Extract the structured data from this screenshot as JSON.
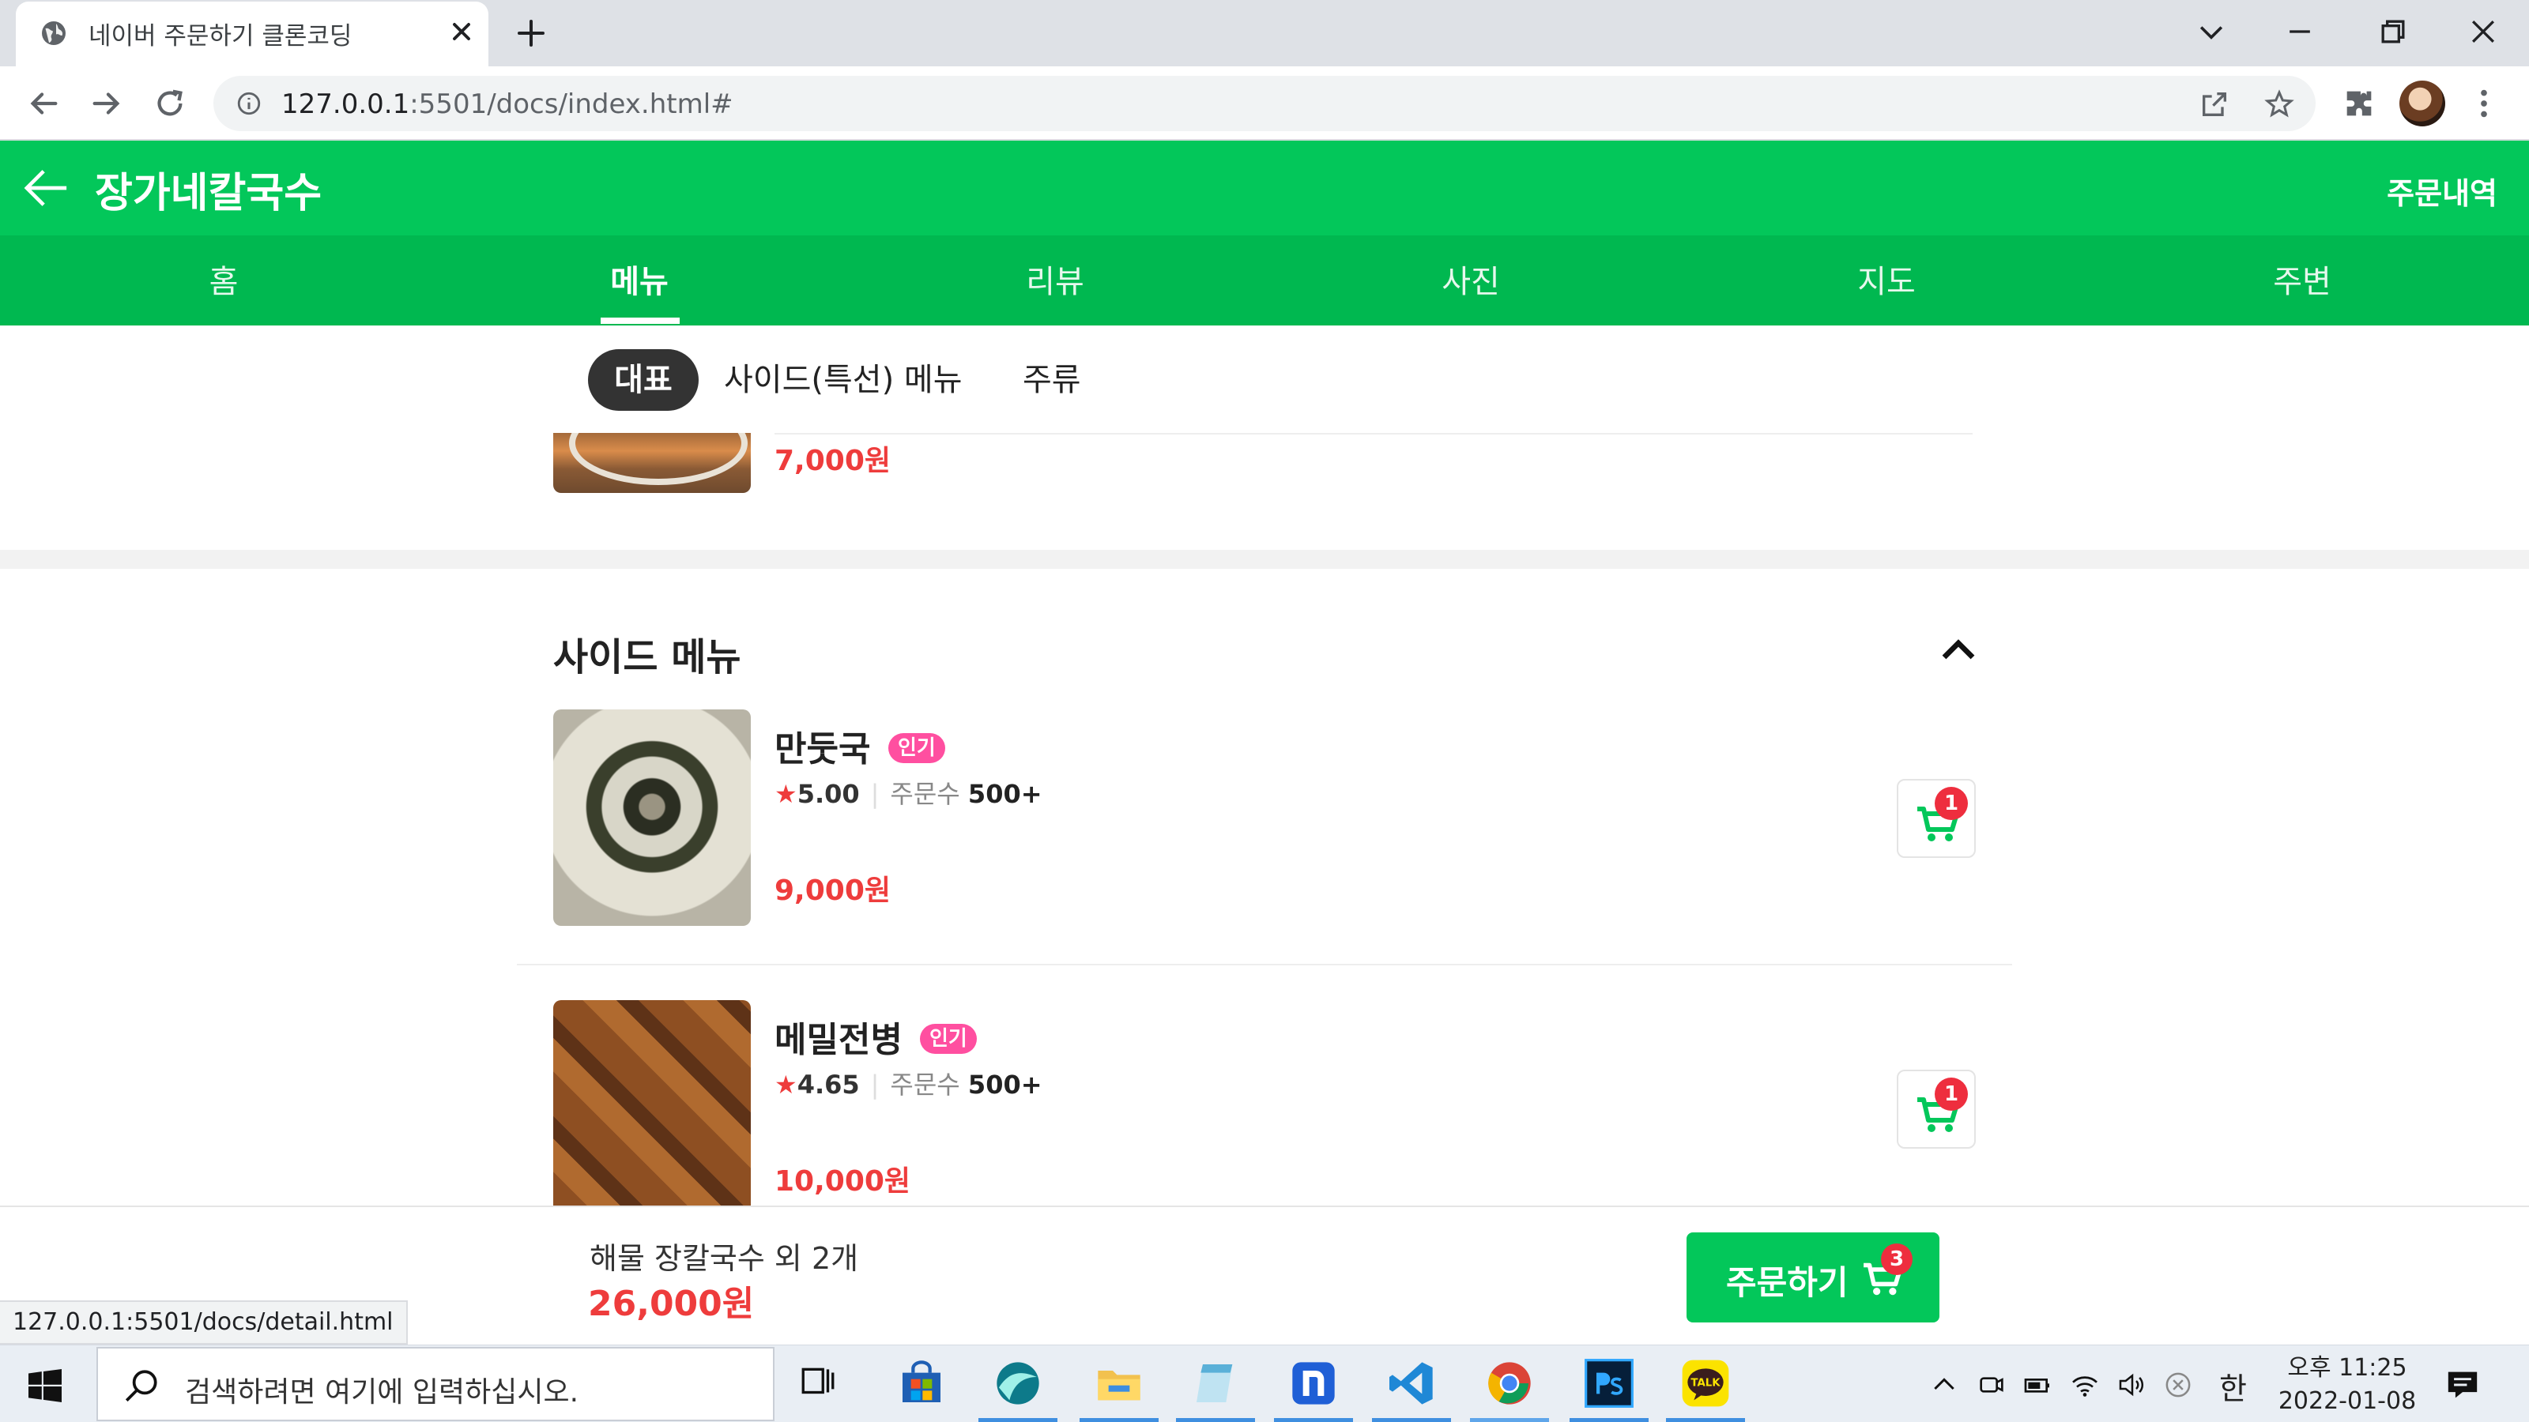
{
  "browser": {
    "tab_title": "네이버 주문하기 클론코딩",
    "url_host": "127.0.0.1",
    "url_rest": ":5501/docs/index.html#",
    "status_url": "127.0.0.1:5501/docs/detail.html"
  },
  "header": {
    "store_name": "장가네칼국수",
    "order_history": "주문내역"
  },
  "nav": {
    "tabs": [
      {
        "label": "홈"
      },
      {
        "label": "메뉴"
      },
      {
        "label": "리뷰"
      },
      {
        "label": "사진"
      },
      {
        "label": "지도"
      },
      {
        "label": "주변"
      }
    ],
    "active_index": 1
  },
  "subcategories": [
    {
      "label": "대표"
    },
    {
      "label": "사이드(특선) 메뉴"
    },
    {
      "label": "주류"
    }
  ],
  "previous_item": {
    "price": "7,000원"
  },
  "side_section": {
    "title": "사이드 메뉴",
    "items": [
      {
        "name": "만둣국",
        "badge": "인기",
        "star": "★",
        "rating": "5.00",
        "orders_label": "주문수",
        "orders_count": "500+",
        "price": "9,000원",
        "cart_count": "1"
      },
      {
        "name": "메밀전병",
        "badge": "인기",
        "star": "★",
        "rating": "4.65",
        "orders_label": "주문수",
        "orders_count": "500+",
        "price": "10,000원",
        "cart_count": "1"
      }
    ]
  },
  "order_bar": {
    "summary": "해물 장칼국수 외 2개",
    "total": "26,000원",
    "button_label": "주문하기",
    "cart_count": "3"
  },
  "taskbar": {
    "search_placeholder": "검색하려면 여기에 입력하십시오.",
    "ime": "한",
    "time": "오후 11:25",
    "date": "2022-01-08"
  },
  "colors": {
    "brand_green": "#03c75a",
    "nav_green": "#00b850",
    "price_red": "#ee3c3c",
    "badge_pink": "#ff4fa0"
  }
}
